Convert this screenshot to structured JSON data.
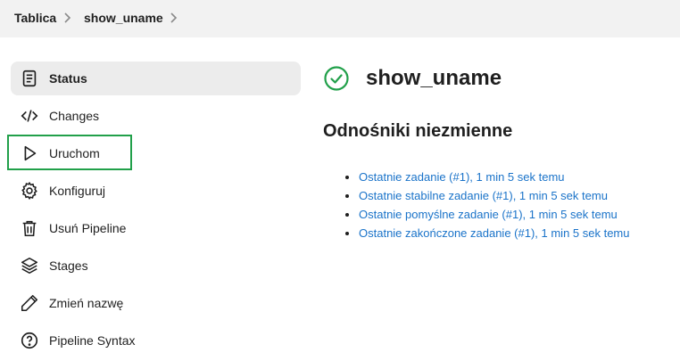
{
  "breadcrumb": {
    "items": [
      "Tablica",
      "show_uname"
    ]
  },
  "sidebar": {
    "items": [
      {
        "label": "Status",
        "icon": "document-icon"
      },
      {
        "label": "Changes",
        "icon": "code-icon"
      },
      {
        "label": "Uruchom",
        "icon": "play-icon"
      },
      {
        "label": "Konfiguruj",
        "icon": "gear-icon"
      },
      {
        "label": "Usuń Pipeline",
        "icon": "trash-icon"
      },
      {
        "label": "Stages",
        "icon": "layers-icon"
      },
      {
        "label": "Zmień nazwę",
        "icon": "pencil-icon"
      },
      {
        "label": "Pipeline Syntax",
        "icon": "help-icon"
      }
    ]
  },
  "main": {
    "title": "show_uname",
    "status_icon": "check-circle-icon",
    "status_color": "#21a04a",
    "subtitle": "Odnośniki niezmienne",
    "links": [
      "Ostatnie zadanie (#1), 1 min 5 sek temu",
      "Ostatnie stabilne zadanie (#1), 1 min 5 sek temu",
      "Ostatnie pomyślne zadanie (#1), 1 min 5 sek temu",
      "Ostatnie zakończone zadanie (#1), 1 min 5 sek temu"
    ]
  },
  "colors": {
    "link": "#1a73c9",
    "highlight": "#21a04a",
    "active_bg": "#ececec"
  }
}
